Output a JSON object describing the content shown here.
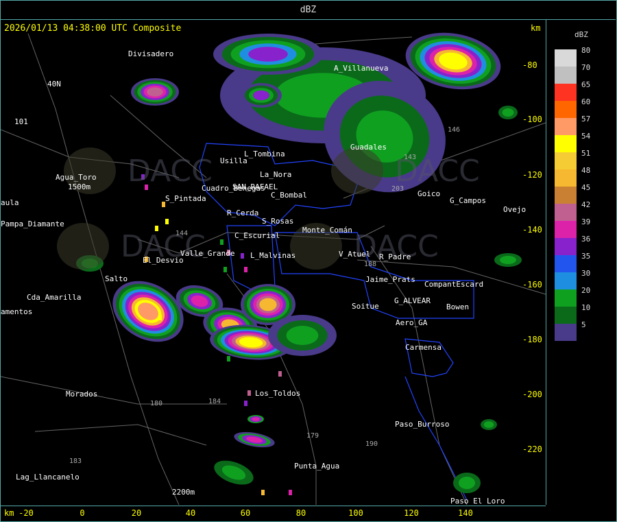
{
  "window": {
    "title": "dBZ"
  },
  "header": {
    "timestamp_product": "2026/01/13 04:38:00 UTC Composite",
    "km_label": "km"
  },
  "legend": {
    "title": "dBZ",
    "levels": [
      {
        "label": "80",
        "color": "#d9d9d9"
      },
      {
        "label": "70",
        "color": "#c0c0c0"
      },
      {
        "label": "65",
        "color": "#ff3322"
      },
      {
        "label": "60",
        "color": "#ff6600"
      },
      {
        "label": "57",
        "color": "#ff9966"
      },
      {
        "label": "54",
        "color": "#ffff00"
      },
      {
        "label": "51",
        "color": "#f5cc33"
      },
      {
        "label": "48",
        "color": "#f5b830"
      },
      {
        "label": "45",
        "color": "#c98033"
      },
      {
        "label": "42",
        "color": "#c06090"
      },
      {
        "label": "39",
        "color": "#dd22aa"
      },
      {
        "label": "36",
        "color": "#8822cc"
      },
      {
        "label": "35",
        "color": "#2255ee"
      },
      {
        "label": "30",
        "color": "#1e8fe0"
      },
      {
        "label": "20",
        "color": "#10a020"
      },
      {
        "label": "10",
        "color": "#0a6a1a"
      },
      {
        "label": "5",
        "color": "#4a3a8a"
      }
    ]
  },
  "axes": {
    "x_unit": "km",
    "x_ticks": [
      "-20",
      "0",
      "20",
      "40",
      "60",
      "80",
      "100",
      "120",
      "140"
    ],
    "y_unit": "km",
    "y_ticks": [
      "-80",
      "-100",
      "-120",
      "-140",
      "-160",
      "-180",
      "-200",
      "-220"
    ]
  },
  "places": [
    {
      "name": "Divisadero"
    },
    {
      "name": "A_Villanueva"
    },
    {
      "name": "40N"
    },
    {
      "name": "101"
    },
    {
      "name": "Agua_Toro"
    },
    {
      "name": "1500m"
    },
    {
      "name": "aula"
    },
    {
      "name": "Pampa_Diamante"
    },
    {
      "name": "Usilla"
    },
    {
      "name": "L_Tombina"
    },
    {
      "name": "La_Nora"
    },
    {
      "name": "Guadales"
    },
    {
      "name": "Goico"
    },
    {
      "name": "G_Campos"
    },
    {
      "name": "Ovejo"
    },
    {
      "name": "Cuadro_Benegas"
    },
    {
      "name": "SAN_RAFAEL"
    },
    {
      "name": "C_Bombal"
    },
    {
      "name": "S_Pintada"
    },
    {
      "name": "R_Cerda"
    },
    {
      "name": "S_Rosas"
    },
    {
      "name": "Monte_Comán"
    },
    {
      "name": "Jaime_Prats"
    },
    {
      "name": "C_Escurial"
    },
    {
      "name": "Valle_Grande"
    },
    {
      "name": "L_Malvinas"
    },
    {
      "name": "V_Atuel"
    },
    {
      "name": "R_Padre"
    },
    {
      "name": "El_Desvio"
    },
    {
      "name": "Salto"
    },
    {
      "name": "CompantEscard"
    },
    {
      "name": "G_ALVEAR"
    },
    {
      "name": "Bowen"
    },
    {
      "name": "Cda_Amarilla"
    },
    {
      "name": "amentos"
    },
    {
      "name": "Soitue"
    },
    {
      "name": "Aero_GA"
    },
    {
      "name": "Carmensa"
    },
    {
      "name": "Morados"
    },
    {
      "name": "Los_Toldos"
    },
    {
      "name": "Paso_Burroso"
    },
    {
      "name": "Lag_Llancanelo"
    },
    {
      "name": "Punta_Agua"
    },
    {
      "name": "2200m"
    },
    {
      "name": "Paso_El_Loro"
    }
  ],
  "routes": [
    "146",
    "143",
    "188",
    "203",
    "184",
    "180",
    "179",
    "190",
    "183",
    "144"
  ],
  "watermark": {
    "text": "DACC"
  }
}
